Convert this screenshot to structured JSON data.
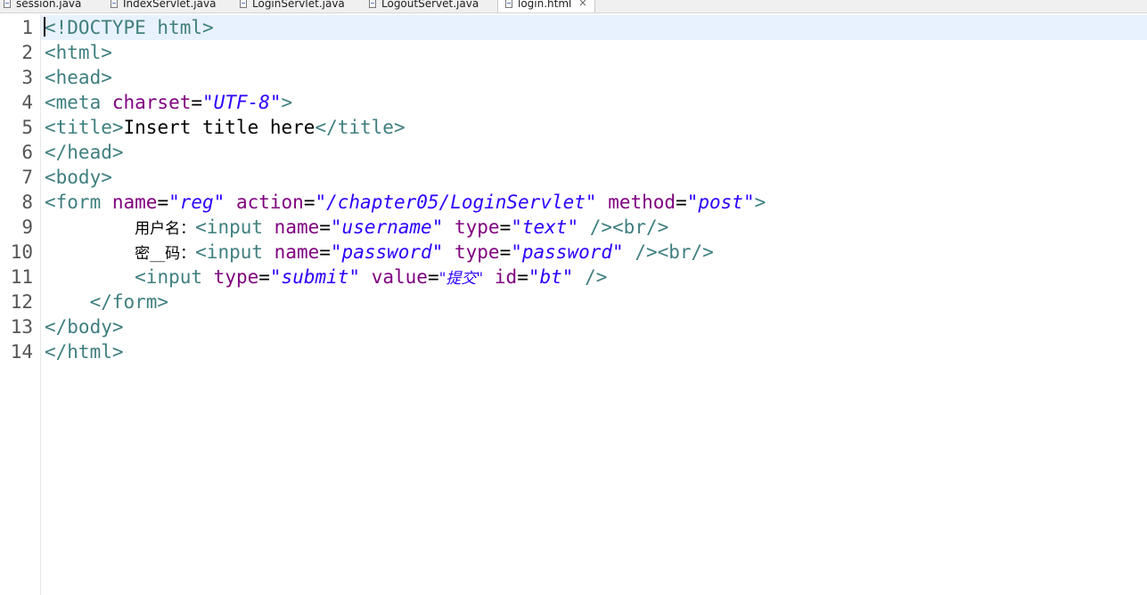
{
  "tabs": [
    {
      "label": "session.java",
      "active": false
    },
    {
      "label": "IndexServlet.java",
      "active": false
    },
    {
      "label": "LoginServlet.java",
      "active": false
    },
    {
      "label": "LogoutServet.java",
      "active": false
    },
    {
      "label": "login.html",
      "active": true
    }
  ],
  "editor": {
    "line_numbers": [
      "1",
      "2",
      "3",
      "4",
      "5",
      "6",
      "7",
      "8",
      "9",
      "10",
      "11",
      "12",
      "13",
      "14"
    ],
    "lines": [
      [
        {
          "t": "tag",
          "s": "<!DOCTYPE html>"
        }
      ],
      [
        {
          "t": "tag",
          "s": "<html>"
        }
      ],
      [
        {
          "t": "tag",
          "s": "<head>"
        }
      ],
      [
        {
          "t": "tag",
          "s": "<meta "
        },
        {
          "t": "attr",
          "s": "charset"
        },
        {
          "t": "txt",
          "s": "="
        },
        {
          "t": "val",
          "s": "\"UTF-8\""
        },
        {
          "t": "tag",
          "s": ">"
        }
      ],
      [
        {
          "t": "tag",
          "s": "<title>"
        },
        {
          "t": "txt",
          "s": "Insert title here"
        },
        {
          "t": "tag",
          "s": "</title>"
        }
      ],
      [
        {
          "t": "tag",
          "s": "</head>"
        }
      ],
      [
        {
          "t": "tag",
          "s": "<body>"
        }
      ],
      [
        {
          "t": "tag",
          "s": "<form "
        },
        {
          "t": "attr",
          "s": "name"
        },
        {
          "t": "txt",
          "s": "="
        },
        {
          "t": "val",
          "s": "\"reg\""
        },
        {
          "t": "txt",
          "s": " "
        },
        {
          "t": "attr",
          "s": "action"
        },
        {
          "t": "txt",
          "s": "="
        },
        {
          "t": "val",
          "s": "\"/chapter05/LoginServlet\""
        },
        {
          "t": "txt",
          "s": " "
        },
        {
          "t": "attr",
          "s": "method"
        },
        {
          "t": "txt",
          "s": "="
        },
        {
          "t": "val",
          "s": "\"post\""
        },
        {
          "t": "tag",
          "s": ">"
        }
      ],
      [
        {
          "t": "txt",
          "s": "        "
        },
        {
          "t": "cjk",
          "s": "用户名："
        },
        {
          "t": "tag",
          "s": "<input "
        },
        {
          "t": "attr",
          "s": "name"
        },
        {
          "t": "txt",
          "s": "="
        },
        {
          "t": "val",
          "s": "\"username\""
        },
        {
          "t": "txt",
          "s": " "
        },
        {
          "t": "attr",
          "s": "type"
        },
        {
          "t": "txt",
          "s": "="
        },
        {
          "t": "val",
          "s": "\"text\""
        },
        {
          "t": "txt",
          "s": " "
        },
        {
          "t": "tag",
          "s": "/><br/>"
        }
      ],
      [
        {
          "t": "txt",
          "s": "        "
        },
        {
          "t": "cjk",
          "s": "密__码："
        },
        {
          "t": "tag",
          "s": "<input "
        },
        {
          "t": "attr",
          "s": "name"
        },
        {
          "t": "txt",
          "s": "="
        },
        {
          "t": "val",
          "s": "\"password\""
        },
        {
          "t": "txt",
          "s": " "
        },
        {
          "t": "attr",
          "s": "type"
        },
        {
          "t": "txt",
          "s": "="
        },
        {
          "t": "val",
          "s": "\"password\""
        },
        {
          "t": "txt",
          "s": " "
        },
        {
          "t": "tag",
          "s": "/><br/>"
        }
      ],
      [
        {
          "t": "txt",
          "s": "        "
        },
        {
          "t": "tag",
          "s": "<input "
        },
        {
          "t": "attr",
          "s": "type"
        },
        {
          "t": "txt",
          "s": "="
        },
        {
          "t": "val",
          "s": "\"submit\""
        },
        {
          "t": "txt",
          "s": " "
        },
        {
          "t": "attr",
          "s": "value"
        },
        {
          "t": "txt",
          "s": "="
        },
        {
          "t": "cjkval",
          "s": "\"提交\""
        },
        {
          "t": "txt",
          "s": " "
        },
        {
          "t": "attr",
          "s": "id"
        },
        {
          "t": "txt",
          "s": "="
        },
        {
          "t": "val",
          "s": "\"bt\""
        },
        {
          "t": "txt",
          "s": " "
        },
        {
          "t": "tag",
          "s": "/>"
        }
      ],
      [
        {
          "t": "txt",
          "s": "    "
        },
        {
          "t": "tag",
          "s": "</form>"
        }
      ],
      [
        {
          "t": "tag",
          "s": "</body>"
        }
      ],
      [
        {
          "t": "tag",
          "s": "</html>"
        }
      ]
    ]
  },
  "colors": {
    "tag": "#3f7f7f",
    "attr": "#7f007f",
    "val": "#2a00ff",
    "text": "#000000",
    "current_line": "#e8f2fe"
  },
  "icons": {
    "tab_file": "java-file-icon",
    "tab_close": "close-icon"
  }
}
